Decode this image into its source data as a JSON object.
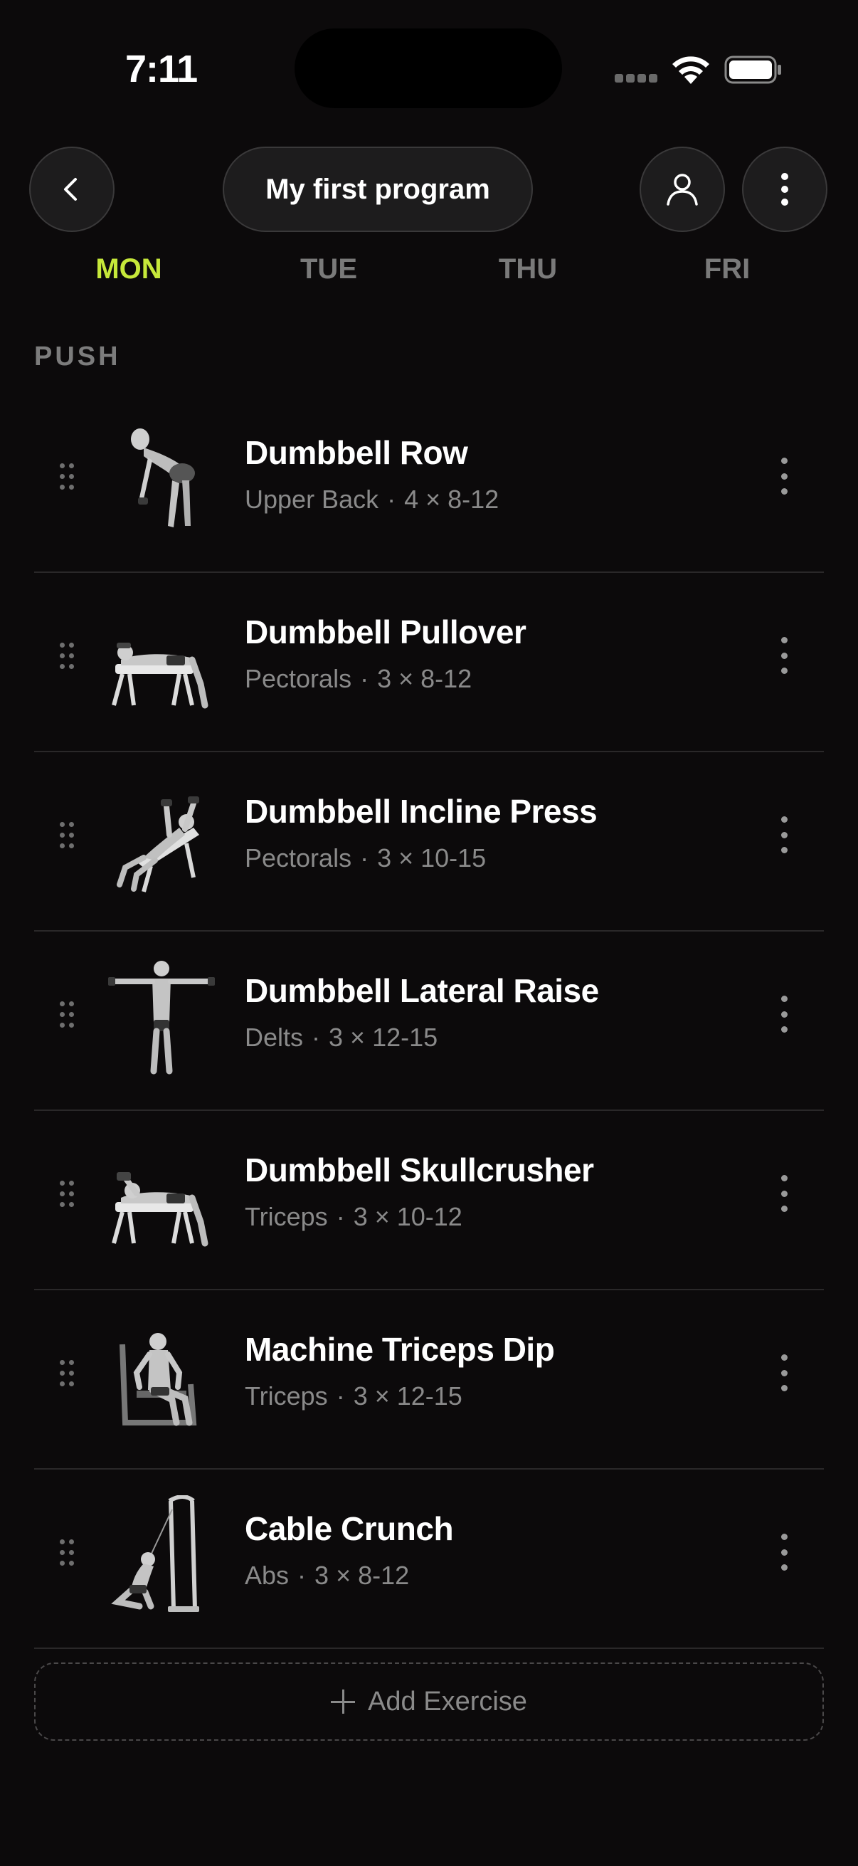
{
  "status_bar": {
    "time": "7:11"
  },
  "header": {
    "title": "My first program",
    "back_icon": "chevron-left-icon",
    "profile_icon": "person-icon",
    "more_icon": "vertical-ellipsis-icon"
  },
  "days": [
    {
      "label": "MON",
      "active": true
    },
    {
      "label": "TUE",
      "active": false
    },
    {
      "label": "THU",
      "active": false
    },
    {
      "label": "FRI",
      "active": false
    }
  ],
  "accent_color": "#c6e83a",
  "section": {
    "label": "PUSH"
  },
  "exercises": [
    {
      "name": "Dumbbell Row",
      "muscle": "Upper Back",
      "scheme": "4 × 8-12"
    },
    {
      "name": "Dumbbell Pullover",
      "muscle": "Pectorals",
      "scheme": "3 × 8-12"
    },
    {
      "name": "Dumbbell Incline Press",
      "muscle": "Pectorals",
      "scheme": "3 × 10-15"
    },
    {
      "name": "Dumbbell Lateral Raise",
      "muscle": "Delts",
      "scheme": "3 × 12-15"
    },
    {
      "name": "Dumbbell Skullcrusher",
      "muscle": "Triceps",
      "scheme": "3 × 10-12"
    },
    {
      "name": "Machine Triceps Dip",
      "muscle": "Triceps",
      "scheme": "3 × 12-15"
    },
    {
      "name": "Cable Crunch",
      "muscle": "Abs",
      "scheme": "3 × 8-12"
    }
  ],
  "add_button": {
    "label": "Add Exercise"
  }
}
